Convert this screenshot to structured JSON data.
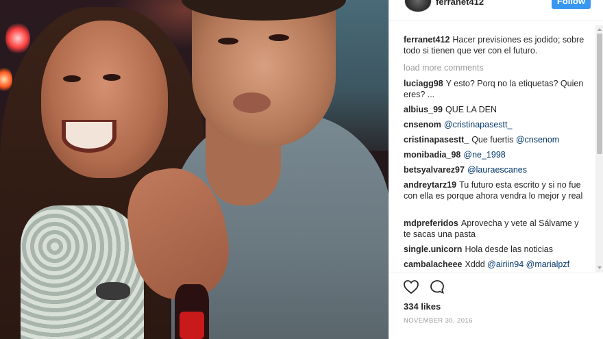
{
  "post": {
    "username": "ferranet412",
    "follow_label": "Follow",
    "likes": "334 likes",
    "date": "NOVEMBER 30, 2016"
  },
  "caption": {
    "username": "ferranet412",
    "text": "Hacer previsiones es jodido; sobre todo si tienen que ver con el futuro."
  },
  "load_more_label": "load more comments",
  "comments": [
    {
      "username": "luciagg98",
      "text": "Y esto? Porq no la etiquetas? Quien eres? ..."
    },
    {
      "username": "albius_99",
      "text": "QUE LA DEN"
    },
    {
      "username": "cnsenom",
      "mention": "@cristinapasestt_"
    },
    {
      "username": "cristinapasestt_",
      "text": "Que fuertis",
      "mention": "@cnsenom"
    },
    {
      "username": "monibadia_98",
      "mention": "@ne_1998"
    },
    {
      "username": "betsyalvarez97",
      "mention": "@lauraescanes"
    },
    {
      "username": "andreytarz19",
      "text": "Tu futuro esta escrito y si no fue con ella es porque ahora vendra lo mejor y real"
    },
    {
      "username": "mdpreferidos",
      "text": "Aprovecha y vete al Sálvame y te sacas una pasta"
    },
    {
      "username": "single.unicorn",
      "text": "Hola desde las noticias"
    },
    {
      "username": "cambalacheee",
      "text": "Xddd",
      "mention": "@airiin94",
      "mention2": "@marialpzf"
    }
  ],
  "icons": {
    "like": "heart-icon",
    "comment": "comment-bubble-icon",
    "avatar": "profile-avatar"
  },
  "colors": {
    "accent": "#3897f0",
    "mention": "#003569",
    "muted": "#999999",
    "text": "#262626"
  }
}
